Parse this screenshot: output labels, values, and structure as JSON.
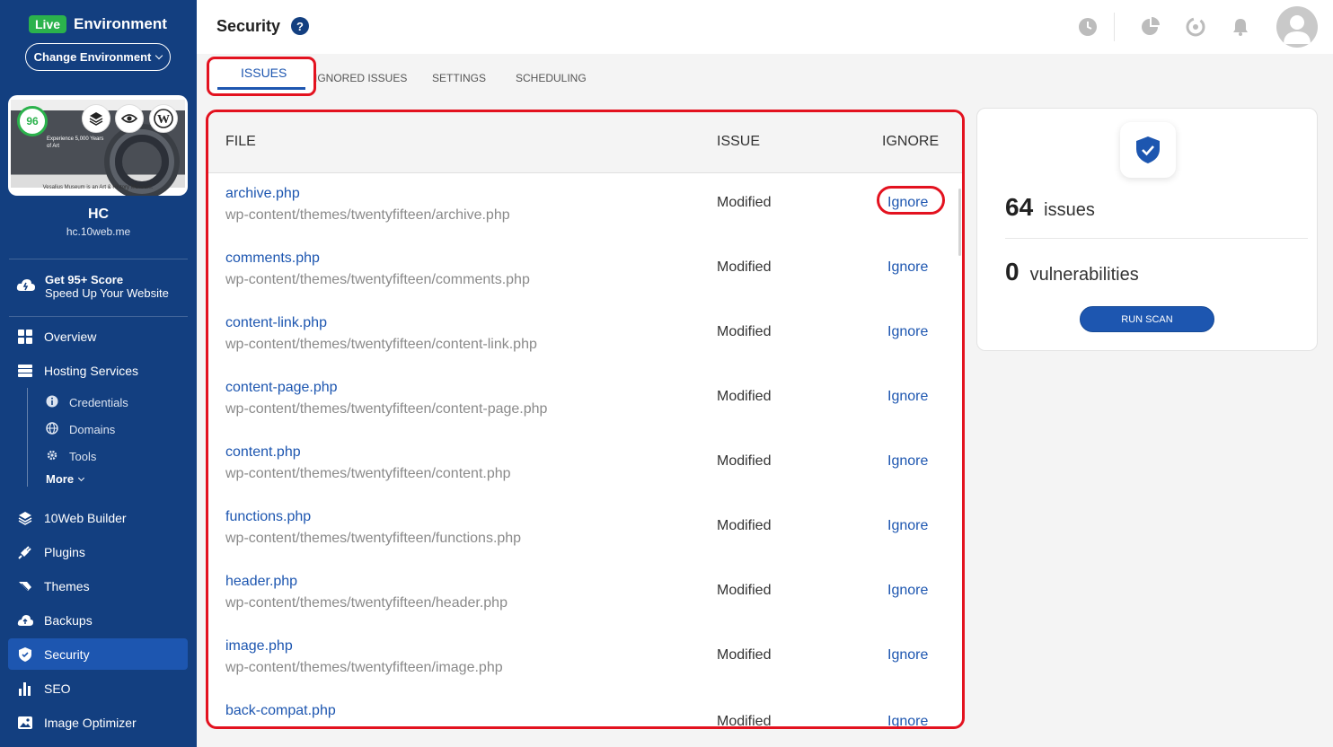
{
  "environment": {
    "badge": "Live",
    "title": "Environment",
    "change_label": "Change Environment"
  },
  "site": {
    "score": "96",
    "name": "HC",
    "url": "hc.10web.me",
    "preview_text": "Experience 5,000 Years of Art",
    "preview_caption": "Vesalius Museum is an Art & History Museum."
  },
  "promo": {
    "title": "Get 95+ Score",
    "subtitle": "Speed Up Your Website"
  },
  "nav": {
    "overview": "Overview",
    "hosting": "Hosting Services",
    "credentials": "Credentials",
    "domains": "Domains",
    "tools": "Tools",
    "more": "More",
    "builder": "10Web Builder",
    "plugins": "Plugins",
    "themes": "Themes",
    "backups": "Backups",
    "security": "Security",
    "seo": "SEO",
    "image_optimizer": "Image Optimizer"
  },
  "header": {
    "title": "Security",
    "help": "?"
  },
  "tabs": {
    "issues": "ISSUES",
    "ignored": "IGNORED ISSUES",
    "settings": "SETTINGS",
    "scheduling": "SCHEDULING"
  },
  "table": {
    "headers": {
      "file": "FILE",
      "issue": "ISSUE",
      "ignore": "IGNORE"
    },
    "rows": [
      {
        "file": "archive.php",
        "path": "wp-content/themes/twentyfifteen/archive.php",
        "issue": "Modified",
        "action": "Ignore"
      },
      {
        "file": "comments.php",
        "path": "wp-content/themes/twentyfifteen/comments.php",
        "issue": "Modified",
        "action": "Ignore"
      },
      {
        "file": "content-link.php",
        "path": "wp-content/themes/twentyfifteen/content-link.php",
        "issue": "Modified",
        "action": "Ignore"
      },
      {
        "file": "content-page.php",
        "path": "wp-content/themes/twentyfifteen/content-page.php",
        "issue": "Modified",
        "action": "Ignore"
      },
      {
        "file": "content.php",
        "path": "wp-content/themes/twentyfifteen/content.php",
        "issue": "Modified",
        "action": "Ignore"
      },
      {
        "file": "functions.php",
        "path": "wp-content/themes/twentyfifteen/functions.php",
        "issue": "Modified",
        "action": "Ignore"
      },
      {
        "file": "header.php",
        "path": "wp-content/themes/twentyfifteen/header.php",
        "issue": "Modified",
        "action": "Ignore"
      },
      {
        "file": "image.php",
        "path": "wp-content/themes/twentyfifteen/image.php",
        "issue": "Modified",
        "action": "Ignore"
      },
      {
        "file": "back-compat.php",
        "path": "",
        "issue": "Modified",
        "action": "Ignore"
      }
    ]
  },
  "stats": {
    "issues_count": "64",
    "issues_label": "issues",
    "vuln_count": "0",
    "vuln_label": "vulnerabilities",
    "scan_button": "RUN SCAN"
  },
  "colors": {
    "sidebar": "#133f80",
    "accent": "#1d56b0",
    "live": "#2bb24c",
    "highlight": "#e3121f"
  }
}
